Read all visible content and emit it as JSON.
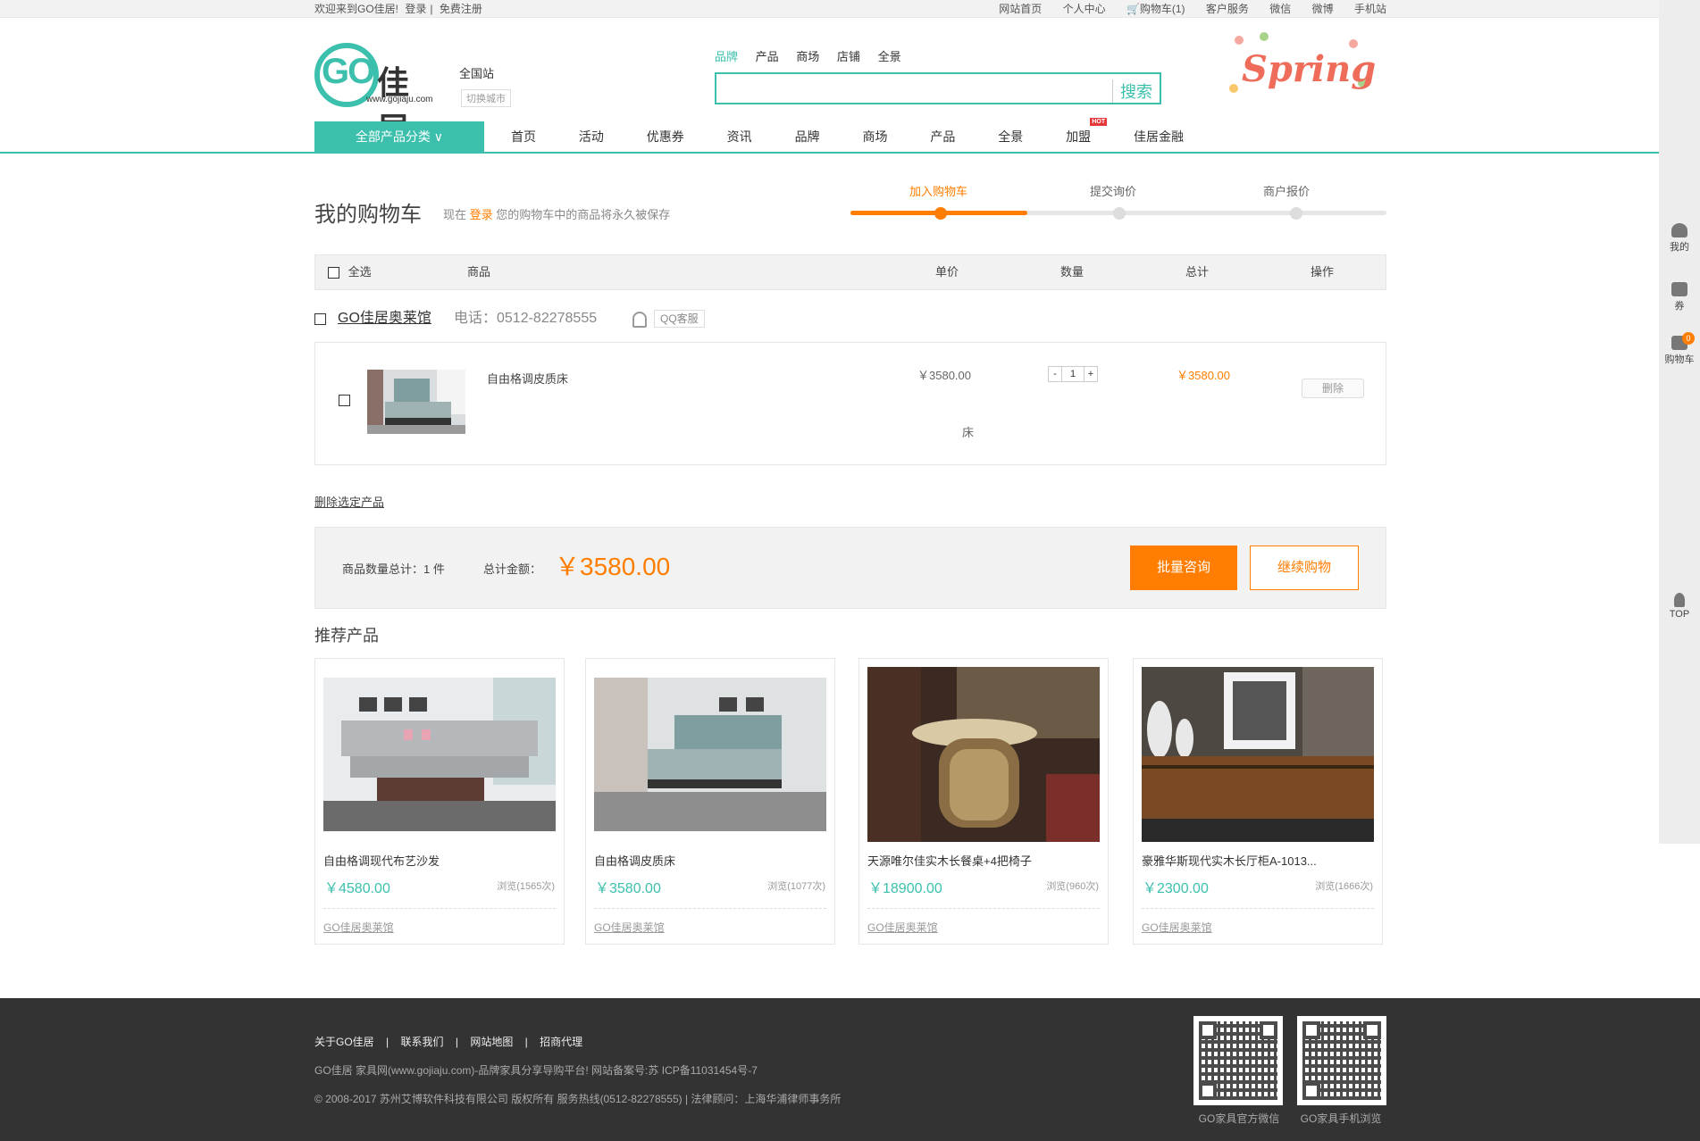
{
  "topbar": {
    "welcome": "欢迎来到GO佳居!",
    "login": "登录",
    "separator": "|",
    "register": "免费注册",
    "links": [
      "网站首页",
      "个人中心",
      "购物车(1)",
      "客户服务",
      "微信",
      "微博",
      "手机站"
    ]
  },
  "header": {
    "logo_go": "GO",
    "logo_cn": "佳居",
    "logo_url": "www.gojiaju.com",
    "city": "全国站",
    "city_switch": "切换城市",
    "search_tabs": [
      "品牌",
      "产品",
      "商场",
      "店铺",
      "全景"
    ],
    "search_placeholder": "",
    "search_button": "搜索",
    "banner_text": "Spring"
  },
  "nav": {
    "category": "全部产品分类 ∨",
    "items": [
      "首页",
      "活动",
      "优惠券",
      "资讯",
      "品牌",
      "商场",
      "产品",
      "全景",
      "加盟",
      "佳居金融"
    ],
    "hot_badge": "HOT"
  },
  "cart": {
    "title": "我的购物车",
    "sub_prefix": "现在",
    "sub_login": "登录",
    "sub_suffix": "您的购物车中的商品将永久被保存",
    "steps": [
      "加入购物车",
      "提交询价",
      "商户报价"
    ],
    "progress": 0.33,
    "columns": [
      "全选",
      "商品",
      "单价",
      "数量",
      "总计",
      "操作"
    ],
    "shop_name": "GO佳居奥莱馆",
    "shop_phone": "电话：0512-82278555",
    "shop_qq": "QQ客服",
    "item": {
      "name": "自由格调皮质床",
      "price": "￥3580.00",
      "spec": "床",
      "qty_minus": "-",
      "qty": "1",
      "qty_plus": "+",
      "total": "￥3580.00",
      "delete": "删除"
    },
    "delete_selected": "删除选定产品",
    "count_label": "商品数量总计：1 件",
    "total_label": "总计金额：",
    "total_amount": "￥3580.00",
    "bulk_button": "批量咨询",
    "continue_button": "继续购物"
  },
  "recommend": {
    "title": "推荐产品",
    "cards": [
      {
        "name": "自由格调现代布艺沙发",
        "price": "￥4580.00",
        "views": "浏览(1565次)",
        "shop": "GO佳居奥莱馆"
      },
      {
        "name": "自由格调皮质床",
        "price": "￥3580.00",
        "views": "浏览(1077次)",
        "shop": "GO佳居奥莱馆"
      },
      {
        "name": "天源唯尔佳实木长餐桌+4把椅子",
        "price": "￥18900.00",
        "views": "浏览(960次)",
        "shop": "GO佳居奥莱馆"
      },
      {
        "name": "豪雅华斯现代实木长厅柜A-1013...",
        "price": "￥2300.00",
        "views": "浏览(1666次)",
        "shop": "GO佳居奥莱馆"
      }
    ]
  },
  "footer": {
    "links": [
      "关于GO佳居",
      "|",
      "联系我们",
      "|",
      "网站地图",
      "|",
      "招商代理"
    ],
    "line1": "GO佳居 家具网(www.gojiaju.com)-品牌家具分享导购平台! 网站备案号:苏 ICP备11031454号-7",
    "line2": "© 2008-2017 苏州艾博软件科技有限公司 版权所有 服务热线(0512-82278555) | 法律顾问：上海华浦律师事务所",
    "qr1_label": "GO家具官方微信",
    "qr2_label": "GO家具手机浏览"
  },
  "sidebar": {
    "mine": "我的",
    "coupon": "券",
    "cart": "购物车",
    "cart_count": "0",
    "top": "TOP"
  },
  "colors": {
    "brand": "#3cc0ad",
    "accent": "#ff7d00",
    "footer": "#333333"
  }
}
